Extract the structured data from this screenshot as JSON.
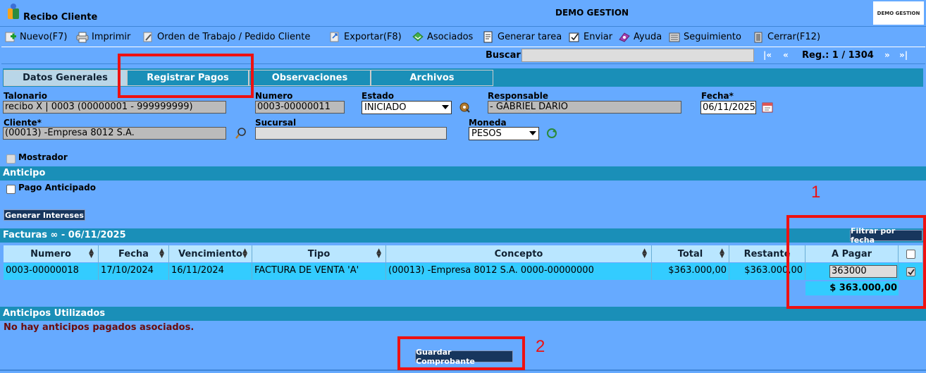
{
  "window": {
    "title": "Recibo Cliente",
    "company": "DEMO GESTION",
    "brand": "DEMO GESTION"
  },
  "toolbar": {
    "items": [
      {
        "label": "Nuevo(F7)",
        "icon": "add-icon"
      },
      {
        "label": "Imprimir",
        "icon": "printer-icon"
      },
      {
        "label": "Orden de Trabajo / Pedido Cliente",
        "icon": "wrench-icon"
      },
      {
        "label": "Exportar(F8)",
        "icon": "export-icon"
      },
      {
        "label": "Asociados",
        "icon": "associated-icon"
      },
      {
        "label": "Generar tarea",
        "icon": "task-icon"
      },
      {
        "label": "Enviar",
        "icon": "send-icon"
      },
      {
        "label": "Ayuda",
        "icon": "help-icon"
      },
      {
        "label": "Seguimiento",
        "icon": "tracking-icon"
      },
      {
        "label": "Cerrar(F12)",
        "icon": "close-icon"
      }
    ]
  },
  "search": {
    "label": "Buscar",
    "value": "",
    "reg": "Reg.: 1 / 1304",
    "nav": [
      "|«",
      "«",
      "»",
      "»|"
    ]
  },
  "tabs": [
    {
      "label": "Datos Generales",
      "active": true
    },
    {
      "label": "Registrar Pagos",
      "active": false
    },
    {
      "label": "Observaciones",
      "active": false
    },
    {
      "label": "Archivos",
      "active": false
    }
  ],
  "form": {
    "talonario": {
      "label": "Talonario",
      "value": "recibo X | 0003 (00000001 - 999999999)"
    },
    "numero": {
      "label": "Numero",
      "value": "0003-00000011"
    },
    "estado": {
      "label": "Estado",
      "value": "INICIADO"
    },
    "responsable": {
      "label": "Responsable",
      "value": "- GABRIEL DARIO"
    },
    "fecha": {
      "label": "Fecha*",
      "value": "06/11/2025"
    },
    "cliente": {
      "label": "Cliente*",
      "value": "(00013) -Empresa 8012 S.A."
    },
    "sucursal": {
      "label": "Sucursal",
      "value": ""
    },
    "moneda": {
      "label": "Moneda",
      "value": "PESOS"
    },
    "mostrador": {
      "label": "Mostrador",
      "checked": false
    }
  },
  "anticipo": {
    "title": "Anticipo",
    "pago_anticipado": "Pago Anticipado",
    "generar_intereses": "Generar Intereses"
  },
  "facturas": {
    "title": "Facturas ∞ - 06/11/2025",
    "filter_button": "Filtrar por fecha",
    "columns": [
      "Numero",
      "Fecha",
      "Vencimiento",
      "Tipo",
      "Concepto",
      "Total",
      "Restante",
      "A Pagar"
    ],
    "rows": [
      {
        "numero": "0003-00000018",
        "fecha": "17/10/2024",
        "vencimiento": "16/11/2024",
        "tipo": "FACTURA DE VENTA 'A'",
        "concepto": "(00013) -Empresa 8012 S.A. 0000-00000000",
        "total": "$363.000,00",
        "restante": "$363.000,00",
        "a_pagar": "363000",
        "checked": true
      }
    ],
    "total_a_pagar": "$ 363.000,00"
  },
  "anticipos_utilizados": {
    "title": "Anticipos Utilizados",
    "empty_message": "No hay anticipos pagados asociados."
  },
  "footer": {
    "save_button": "Guardar Comprobante"
  },
  "annotations": {
    "num1": "1",
    "num2": "2"
  },
  "colors": {
    "background": "#66aaff",
    "section": "#1a8fb8",
    "annotation": "#ee1111",
    "row": "#33ccff"
  }
}
